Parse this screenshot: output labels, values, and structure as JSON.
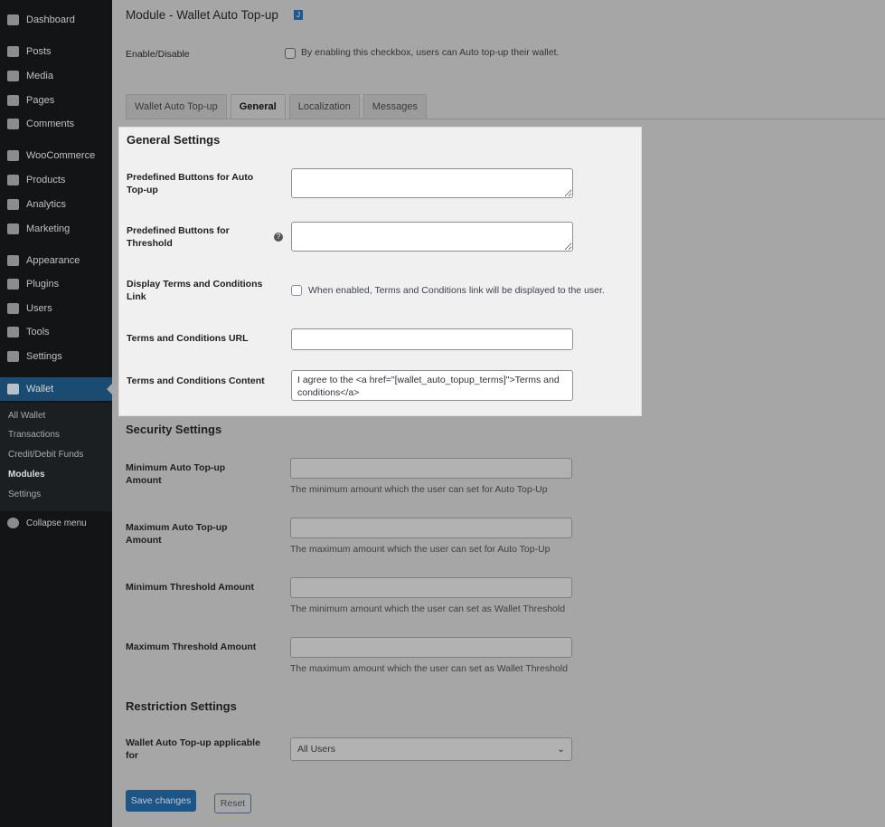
{
  "sidebar": {
    "items": [
      "Dashboard",
      "Posts",
      "Media",
      "Pages",
      "Comments",
      "WooCommerce",
      "Products",
      "Analytics",
      "Marketing",
      "Appearance",
      "Plugins",
      "Users",
      "Tools",
      "Settings",
      "Wallet"
    ],
    "submenu": [
      "All Wallet",
      "Transactions",
      "Credit/Debit Funds",
      "Modules",
      "Settings"
    ],
    "collapse": "Collapse menu"
  },
  "header": {
    "title": "Module - Wallet Auto Top-up",
    "badge": "J"
  },
  "enable": {
    "label": "Enable/Disable",
    "text": "By enabling this checkbox, users can Auto top-up their wallet."
  },
  "tabs": [
    "Wallet Auto Top-up",
    "General",
    "Localization",
    "Messages"
  ],
  "general": {
    "title": "General Settings",
    "auto_label": "Predefined Buttons for Auto Top-up",
    "threshold_label": "Predefined Buttons for Threshold",
    "terms_link_label": "Display Terms and Conditions Link",
    "terms_link_text": "When enabled, Terms and Conditions link will be displayed to the user.",
    "url_label": "Terms and Conditions URL",
    "content_label": "Terms and Conditions Content",
    "content_value": "I agree to the <a href=\"[wallet_auto_topup_terms]\">Terms and conditions</a>"
  },
  "security": {
    "title": "Security Settings",
    "rows": [
      {
        "label": "Minimum Auto Top-up Amount",
        "desc": "The minimum amount which the user can set for Auto Top-Up"
      },
      {
        "label": "Maximum Auto Top-up Amount",
        "desc": "The maximum amount which the user can set for Auto Top-Up"
      },
      {
        "label": "Minimum Threshold Amount",
        "desc": "The minimum amount which the user can set as Wallet Threshold"
      },
      {
        "label": "Maximum Threshold Amount",
        "desc": "The maximum amount which the user can set as Wallet Threshold"
      }
    ]
  },
  "restriction": {
    "title": "Restriction Settings",
    "label": "Wallet Auto Top-up applicable for",
    "value": "All Users"
  },
  "buttons": {
    "save": "Save changes",
    "reset": "Reset"
  }
}
